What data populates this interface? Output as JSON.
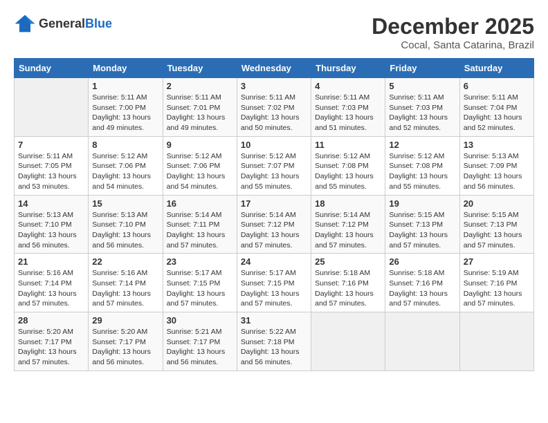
{
  "logo": {
    "general": "General",
    "blue": "Blue"
  },
  "header": {
    "title": "December 2025",
    "subtitle": "Cocal, Santa Catarina, Brazil"
  },
  "days_of_week": [
    "Sunday",
    "Monday",
    "Tuesday",
    "Wednesday",
    "Thursday",
    "Friday",
    "Saturday"
  ],
  "weeks": [
    [
      {
        "day": "",
        "empty": true
      },
      {
        "day": "1",
        "sunrise": "Sunrise: 5:11 AM",
        "sunset": "Sunset: 7:00 PM",
        "daylight": "Daylight: 13 hours and 49 minutes."
      },
      {
        "day": "2",
        "sunrise": "Sunrise: 5:11 AM",
        "sunset": "Sunset: 7:01 PM",
        "daylight": "Daylight: 13 hours and 49 minutes."
      },
      {
        "day": "3",
        "sunrise": "Sunrise: 5:11 AM",
        "sunset": "Sunset: 7:02 PM",
        "daylight": "Daylight: 13 hours and 50 minutes."
      },
      {
        "day": "4",
        "sunrise": "Sunrise: 5:11 AM",
        "sunset": "Sunset: 7:03 PM",
        "daylight": "Daylight: 13 hours and 51 minutes."
      },
      {
        "day": "5",
        "sunrise": "Sunrise: 5:11 AM",
        "sunset": "Sunset: 7:03 PM",
        "daylight": "Daylight: 13 hours and 52 minutes."
      },
      {
        "day": "6",
        "sunrise": "Sunrise: 5:11 AM",
        "sunset": "Sunset: 7:04 PM",
        "daylight": "Daylight: 13 hours and 52 minutes."
      }
    ],
    [
      {
        "day": "7",
        "sunrise": "Sunrise: 5:11 AM",
        "sunset": "Sunset: 7:05 PM",
        "daylight": "Daylight: 13 hours and 53 minutes."
      },
      {
        "day": "8",
        "sunrise": "Sunrise: 5:12 AM",
        "sunset": "Sunset: 7:06 PM",
        "daylight": "Daylight: 13 hours and 54 minutes."
      },
      {
        "day": "9",
        "sunrise": "Sunrise: 5:12 AM",
        "sunset": "Sunset: 7:06 PM",
        "daylight": "Daylight: 13 hours and 54 minutes."
      },
      {
        "day": "10",
        "sunrise": "Sunrise: 5:12 AM",
        "sunset": "Sunset: 7:07 PM",
        "daylight": "Daylight: 13 hours and 55 minutes."
      },
      {
        "day": "11",
        "sunrise": "Sunrise: 5:12 AM",
        "sunset": "Sunset: 7:08 PM",
        "daylight": "Daylight: 13 hours and 55 minutes."
      },
      {
        "day": "12",
        "sunrise": "Sunrise: 5:12 AM",
        "sunset": "Sunset: 7:08 PM",
        "daylight": "Daylight: 13 hours and 55 minutes."
      },
      {
        "day": "13",
        "sunrise": "Sunrise: 5:13 AM",
        "sunset": "Sunset: 7:09 PM",
        "daylight": "Daylight: 13 hours and 56 minutes."
      }
    ],
    [
      {
        "day": "14",
        "sunrise": "Sunrise: 5:13 AM",
        "sunset": "Sunset: 7:10 PM",
        "daylight": "Daylight: 13 hours and 56 minutes."
      },
      {
        "day": "15",
        "sunrise": "Sunrise: 5:13 AM",
        "sunset": "Sunset: 7:10 PM",
        "daylight": "Daylight: 13 hours and 56 minutes."
      },
      {
        "day": "16",
        "sunrise": "Sunrise: 5:14 AM",
        "sunset": "Sunset: 7:11 PM",
        "daylight": "Daylight: 13 hours and 57 minutes."
      },
      {
        "day": "17",
        "sunrise": "Sunrise: 5:14 AM",
        "sunset": "Sunset: 7:12 PM",
        "daylight": "Daylight: 13 hours and 57 minutes."
      },
      {
        "day": "18",
        "sunrise": "Sunrise: 5:14 AM",
        "sunset": "Sunset: 7:12 PM",
        "daylight": "Daylight: 13 hours and 57 minutes."
      },
      {
        "day": "19",
        "sunrise": "Sunrise: 5:15 AM",
        "sunset": "Sunset: 7:13 PM",
        "daylight": "Daylight: 13 hours and 57 minutes."
      },
      {
        "day": "20",
        "sunrise": "Sunrise: 5:15 AM",
        "sunset": "Sunset: 7:13 PM",
        "daylight": "Daylight: 13 hours and 57 minutes."
      }
    ],
    [
      {
        "day": "21",
        "sunrise": "Sunrise: 5:16 AM",
        "sunset": "Sunset: 7:14 PM",
        "daylight": "Daylight: 13 hours and 57 minutes."
      },
      {
        "day": "22",
        "sunrise": "Sunrise: 5:16 AM",
        "sunset": "Sunset: 7:14 PM",
        "daylight": "Daylight: 13 hours and 57 minutes."
      },
      {
        "day": "23",
        "sunrise": "Sunrise: 5:17 AM",
        "sunset": "Sunset: 7:15 PM",
        "daylight": "Daylight: 13 hours and 57 minutes."
      },
      {
        "day": "24",
        "sunrise": "Sunrise: 5:17 AM",
        "sunset": "Sunset: 7:15 PM",
        "daylight": "Daylight: 13 hours and 57 minutes."
      },
      {
        "day": "25",
        "sunrise": "Sunrise: 5:18 AM",
        "sunset": "Sunset: 7:16 PM",
        "daylight": "Daylight: 13 hours and 57 minutes."
      },
      {
        "day": "26",
        "sunrise": "Sunrise: 5:18 AM",
        "sunset": "Sunset: 7:16 PM",
        "daylight": "Daylight: 13 hours and 57 minutes."
      },
      {
        "day": "27",
        "sunrise": "Sunrise: 5:19 AM",
        "sunset": "Sunset: 7:16 PM",
        "daylight": "Daylight: 13 hours and 57 minutes."
      }
    ],
    [
      {
        "day": "28",
        "sunrise": "Sunrise: 5:20 AM",
        "sunset": "Sunset: 7:17 PM",
        "daylight": "Daylight: 13 hours and 57 minutes."
      },
      {
        "day": "29",
        "sunrise": "Sunrise: 5:20 AM",
        "sunset": "Sunset: 7:17 PM",
        "daylight": "Daylight: 13 hours and 56 minutes."
      },
      {
        "day": "30",
        "sunrise": "Sunrise: 5:21 AM",
        "sunset": "Sunset: 7:17 PM",
        "daylight": "Daylight: 13 hours and 56 minutes."
      },
      {
        "day": "31",
        "sunrise": "Sunrise: 5:22 AM",
        "sunset": "Sunset: 7:18 PM",
        "daylight": "Daylight: 13 hours and 56 minutes."
      },
      {
        "day": "",
        "empty": true
      },
      {
        "day": "",
        "empty": true
      },
      {
        "day": "",
        "empty": true
      }
    ]
  ]
}
